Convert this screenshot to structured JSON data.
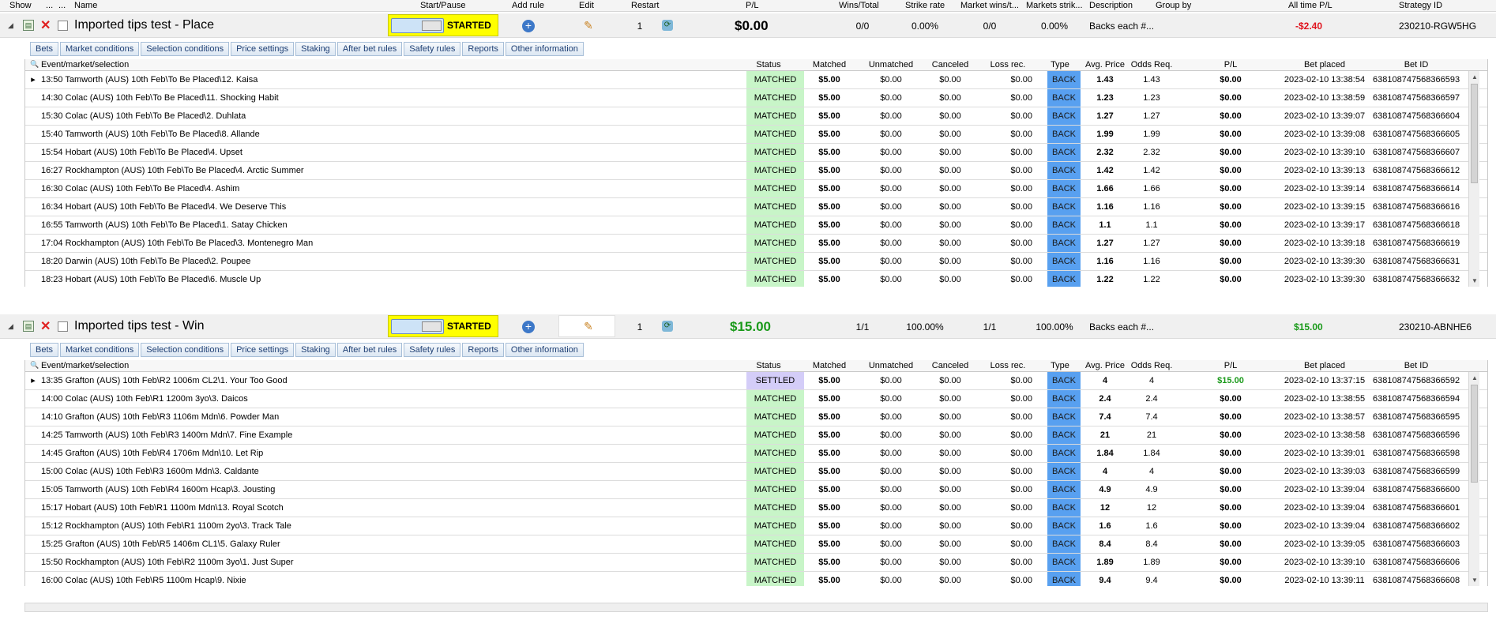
{
  "columns": {
    "show": "Show",
    "dots1": "...",
    "dots2": "...",
    "name": "Name",
    "start_pause": "Start/Pause",
    "add_rule": "Add rule",
    "edit": "Edit",
    "restart": "Restart",
    "pl": "P/L",
    "wins_total": "Wins/Total",
    "strike_rate": "Strike rate",
    "market_wins": "Market wins/t...",
    "markets_strike": "Markets strik...",
    "description": "Description",
    "group_by": "Group by",
    "all_time_pl": "All time P/L",
    "strategy_id": "Strategy ID"
  },
  "tabs": [
    "Bets",
    "Market conditions",
    "Selection conditions",
    "Price settings",
    "Staking",
    "After bet rules",
    "Safety rules",
    "Reports",
    "Other information"
  ],
  "grid_columns": {
    "event": "Event/market/selection",
    "status": "Status",
    "matched": "Matched",
    "unmatched": "Unmatched",
    "canceled": "Canceled",
    "loss_rec": "Loss rec.",
    "type": "Type",
    "avg_price": "Avg. Price",
    "odds_req": "Odds Req.",
    "pl": "P/L",
    "bet_placed": "Bet placed",
    "bet_id": "Bet ID"
  },
  "strategies": [
    {
      "name": "Imported tips test - Place",
      "state": "STARTED",
      "restart": "1",
      "pl": "$0.00",
      "wins_total": "0/0",
      "strike_rate": "0.00%",
      "market_wins": "0/0",
      "markets_strike": "0.00%",
      "description": "Backs each #...",
      "group_by": "",
      "all_time_pl": "-$2.40",
      "strategy_id": "230210-RGW5HG",
      "bets": [
        {
          "event": "13:50 Tamworth (AUS) 10th Feb\\To Be Placed\\12. Kaisa",
          "status": "MATCHED",
          "matched": "$5.00",
          "unmatched": "$0.00",
          "canceled": "$0.00",
          "loss_rec": "$0.00",
          "type": "BACK",
          "avg_price": "1.43",
          "odds_req": "1.43",
          "pl": "$0.00",
          "bet_placed": "2023-02-10 13:38:54",
          "bet_id": "638108747568366593"
        },
        {
          "event": "14:30 Colac (AUS) 10th Feb\\To Be Placed\\11. Shocking Habit",
          "status": "MATCHED",
          "matched": "$5.00",
          "unmatched": "$0.00",
          "canceled": "$0.00",
          "loss_rec": "$0.00",
          "type": "BACK",
          "avg_price": "1.23",
          "odds_req": "1.23",
          "pl": "$0.00",
          "bet_placed": "2023-02-10 13:38:59",
          "bet_id": "638108747568366597"
        },
        {
          "event": "15:30 Colac (AUS) 10th Feb\\To Be Placed\\2. Duhlata",
          "status": "MATCHED",
          "matched": "$5.00",
          "unmatched": "$0.00",
          "canceled": "$0.00",
          "loss_rec": "$0.00",
          "type": "BACK",
          "avg_price": "1.27",
          "odds_req": "1.27",
          "pl": "$0.00",
          "bet_placed": "2023-02-10 13:39:07",
          "bet_id": "638108747568366604"
        },
        {
          "event": "15:40 Tamworth (AUS) 10th Feb\\To Be Placed\\8. Allande",
          "status": "MATCHED",
          "matched": "$5.00",
          "unmatched": "$0.00",
          "canceled": "$0.00",
          "loss_rec": "$0.00",
          "type": "BACK",
          "avg_price": "1.99",
          "odds_req": "1.99",
          "pl": "$0.00",
          "bet_placed": "2023-02-10 13:39:08",
          "bet_id": "638108747568366605"
        },
        {
          "event": "15:54 Hobart (AUS) 10th Feb\\To Be Placed\\4. Upset",
          "status": "MATCHED",
          "matched": "$5.00",
          "unmatched": "$0.00",
          "canceled": "$0.00",
          "loss_rec": "$0.00",
          "type": "BACK",
          "avg_price": "2.32",
          "odds_req": "2.32",
          "pl": "$0.00",
          "bet_placed": "2023-02-10 13:39:10",
          "bet_id": "638108747568366607"
        },
        {
          "event": "16:27 Rockhampton (AUS) 10th Feb\\To Be Placed\\4. Arctic Summer",
          "status": "MATCHED",
          "matched": "$5.00",
          "unmatched": "$0.00",
          "canceled": "$0.00",
          "loss_rec": "$0.00",
          "type": "BACK",
          "avg_price": "1.42",
          "odds_req": "1.42",
          "pl": "$0.00",
          "bet_placed": "2023-02-10 13:39:13",
          "bet_id": "638108747568366612"
        },
        {
          "event": "16:30 Colac (AUS) 10th Feb\\To Be Placed\\4. Ashim",
          "status": "MATCHED",
          "matched": "$5.00",
          "unmatched": "$0.00",
          "canceled": "$0.00",
          "loss_rec": "$0.00",
          "type": "BACK",
          "avg_price": "1.66",
          "odds_req": "1.66",
          "pl": "$0.00",
          "bet_placed": "2023-02-10 13:39:14",
          "bet_id": "638108747568366614"
        },
        {
          "event": "16:34 Hobart (AUS) 10th Feb\\To Be Placed\\4. We Deserve This",
          "status": "MATCHED",
          "matched": "$5.00",
          "unmatched": "$0.00",
          "canceled": "$0.00",
          "loss_rec": "$0.00",
          "type": "BACK",
          "avg_price": "1.16",
          "odds_req": "1.16",
          "pl": "$0.00",
          "bet_placed": "2023-02-10 13:39:15",
          "bet_id": "638108747568366616"
        },
        {
          "event": "16:55 Tamworth (AUS) 10th Feb\\To Be Placed\\1. Satay Chicken",
          "status": "MATCHED",
          "matched": "$5.00",
          "unmatched": "$0.00",
          "canceled": "$0.00",
          "loss_rec": "$0.00",
          "type": "BACK",
          "avg_price": "1.1",
          "odds_req": "1.1",
          "pl": "$0.00",
          "bet_placed": "2023-02-10 13:39:17",
          "bet_id": "638108747568366618"
        },
        {
          "event": "17:04 Rockhampton (AUS) 10th Feb\\To Be Placed\\3. Montenegro Man",
          "status": "MATCHED",
          "matched": "$5.00",
          "unmatched": "$0.00",
          "canceled": "$0.00",
          "loss_rec": "$0.00",
          "type": "BACK",
          "avg_price": "1.27",
          "odds_req": "1.27",
          "pl": "$0.00",
          "bet_placed": "2023-02-10 13:39:18",
          "bet_id": "638108747568366619"
        },
        {
          "event": "18:20 Darwin (AUS) 10th Feb\\To Be Placed\\2. Poupee",
          "status": "MATCHED",
          "matched": "$5.00",
          "unmatched": "$0.00",
          "canceled": "$0.00",
          "loss_rec": "$0.00",
          "type": "BACK",
          "avg_price": "1.16",
          "odds_req": "1.16",
          "pl": "$0.00",
          "bet_placed": "2023-02-10 13:39:30",
          "bet_id": "638108747568366631"
        },
        {
          "event": "18:23 Hobart (AUS) 10th Feb\\To Be Placed\\6. Muscle Up",
          "status": "MATCHED",
          "matched": "$5.00",
          "unmatched": "$0.00",
          "canceled": "$0.00",
          "loss_rec": "$0.00",
          "type": "BACK",
          "avg_price": "1.22",
          "odds_req": "1.22",
          "pl": "$0.00",
          "bet_placed": "2023-02-10 13:39:30",
          "bet_id": "638108747568366632"
        }
      ]
    },
    {
      "name": "Imported tips test - Win",
      "state": "STARTED",
      "restart": "1",
      "pl": "$15.00",
      "wins_total": "1/1",
      "strike_rate": "100.00%",
      "market_wins": "1/1",
      "markets_strike": "100.00%",
      "description": "Backs each #...",
      "group_by": "",
      "all_time_pl": "$15.00",
      "strategy_id": "230210-ABNHE6",
      "bets": [
        {
          "event": "13:35 Grafton (AUS) 10th Feb\\R2 1006m CL2\\1. Your Too Good",
          "status": "SETTLED",
          "matched": "$5.00",
          "unmatched": "$0.00",
          "canceled": "$0.00",
          "loss_rec": "$0.00",
          "type": "BACK",
          "avg_price": "4",
          "odds_req": "4",
          "pl": "$15.00",
          "bet_placed": "2023-02-10 13:37:15",
          "bet_id": "638108747568366592"
        },
        {
          "event": "14:00 Colac (AUS) 10th Feb\\R1 1200m 3yo\\3. Daicos",
          "status": "MATCHED",
          "matched": "$5.00",
          "unmatched": "$0.00",
          "canceled": "$0.00",
          "loss_rec": "$0.00",
          "type": "BACK",
          "avg_price": "2.4",
          "odds_req": "2.4",
          "pl": "$0.00",
          "bet_placed": "2023-02-10 13:38:55",
          "bet_id": "638108747568366594"
        },
        {
          "event": "14:10 Grafton (AUS) 10th Feb\\R3 1106m Mdn\\6. Powder Man",
          "status": "MATCHED",
          "matched": "$5.00",
          "unmatched": "$0.00",
          "canceled": "$0.00",
          "loss_rec": "$0.00",
          "type": "BACK",
          "avg_price": "7.4",
          "odds_req": "7.4",
          "pl": "$0.00",
          "bet_placed": "2023-02-10 13:38:57",
          "bet_id": "638108747568366595"
        },
        {
          "event": "14:25 Tamworth (AUS) 10th Feb\\R3 1400m Mdn\\7. Fine Example",
          "status": "MATCHED",
          "matched": "$5.00",
          "unmatched": "$0.00",
          "canceled": "$0.00",
          "loss_rec": "$0.00",
          "type": "BACK",
          "avg_price": "21",
          "odds_req": "21",
          "pl": "$0.00",
          "bet_placed": "2023-02-10 13:38:58",
          "bet_id": "638108747568366596"
        },
        {
          "event": "14:45 Grafton (AUS) 10th Feb\\R4 1706m Mdn\\10. Let Rip",
          "status": "MATCHED",
          "matched": "$5.00",
          "unmatched": "$0.00",
          "canceled": "$0.00",
          "loss_rec": "$0.00",
          "type": "BACK",
          "avg_price": "1.84",
          "odds_req": "1.84",
          "pl": "$0.00",
          "bet_placed": "2023-02-10 13:39:01",
          "bet_id": "638108747568366598"
        },
        {
          "event": "15:00 Colac (AUS) 10th Feb\\R3 1600m Mdn\\3. Caldante",
          "status": "MATCHED",
          "matched": "$5.00",
          "unmatched": "$0.00",
          "canceled": "$0.00",
          "loss_rec": "$0.00",
          "type": "BACK",
          "avg_price": "4",
          "odds_req": "4",
          "pl": "$0.00",
          "bet_placed": "2023-02-10 13:39:03",
          "bet_id": "638108747568366599"
        },
        {
          "event": "15:05 Tamworth (AUS) 10th Feb\\R4 1600m Hcap\\3. Jousting",
          "status": "MATCHED",
          "matched": "$5.00",
          "unmatched": "$0.00",
          "canceled": "$0.00",
          "loss_rec": "$0.00",
          "type": "BACK",
          "avg_price": "4.9",
          "odds_req": "4.9",
          "pl": "$0.00",
          "bet_placed": "2023-02-10 13:39:04",
          "bet_id": "638108747568366600"
        },
        {
          "event": "15:17 Hobart (AUS) 10th Feb\\R1 1100m Mdn\\13. Royal Scotch",
          "status": "MATCHED",
          "matched": "$5.00",
          "unmatched": "$0.00",
          "canceled": "$0.00",
          "loss_rec": "$0.00",
          "type": "BACK",
          "avg_price": "12",
          "odds_req": "12",
          "pl": "$0.00",
          "bet_placed": "2023-02-10 13:39:04",
          "bet_id": "638108747568366601"
        },
        {
          "event": "15:12 Rockhampton (AUS) 10th Feb\\R1 1100m 2yo\\3. Track Tale",
          "status": "MATCHED",
          "matched": "$5.00",
          "unmatched": "$0.00",
          "canceled": "$0.00",
          "loss_rec": "$0.00",
          "type": "BACK",
          "avg_price": "1.6",
          "odds_req": "1.6",
          "pl": "$0.00",
          "bet_placed": "2023-02-10 13:39:04",
          "bet_id": "638108747568366602"
        },
        {
          "event": "15:25 Grafton (AUS) 10th Feb\\R5 1406m CL1\\5. Galaxy Ruler",
          "status": "MATCHED",
          "matched": "$5.00",
          "unmatched": "$0.00",
          "canceled": "$0.00",
          "loss_rec": "$0.00",
          "type": "BACK",
          "avg_price": "8.4",
          "odds_req": "8.4",
          "pl": "$0.00",
          "bet_placed": "2023-02-10 13:39:05",
          "bet_id": "638108747568366603"
        },
        {
          "event": "15:50 Rockhampton (AUS) 10th Feb\\R2 1100m 3yo\\1. Just Super",
          "status": "MATCHED",
          "matched": "$5.00",
          "unmatched": "$0.00",
          "canceled": "$0.00",
          "loss_rec": "$0.00",
          "type": "BACK",
          "avg_price": "1.89",
          "odds_req": "1.89",
          "pl": "$0.00",
          "bet_placed": "2023-02-10 13:39:10",
          "bet_id": "638108747568366606"
        },
        {
          "event": "16:00 Colac (AUS) 10th Feb\\R5 1100m Hcap\\9. Nixie",
          "status": "MATCHED",
          "matched": "$5.00",
          "unmatched": "$0.00",
          "canceled": "$0.00",
          "loss_rec": "$0.00",
          "type": "BACK",
          "avg_price": "9.4",
          "odds_req": "9.4",
          "pl": "$0.00",
          "bet_placed": "2023-02-10 13:39:11",
          "bet_id": "638108747568366608"
        }
      ]
    }
  ]
}
